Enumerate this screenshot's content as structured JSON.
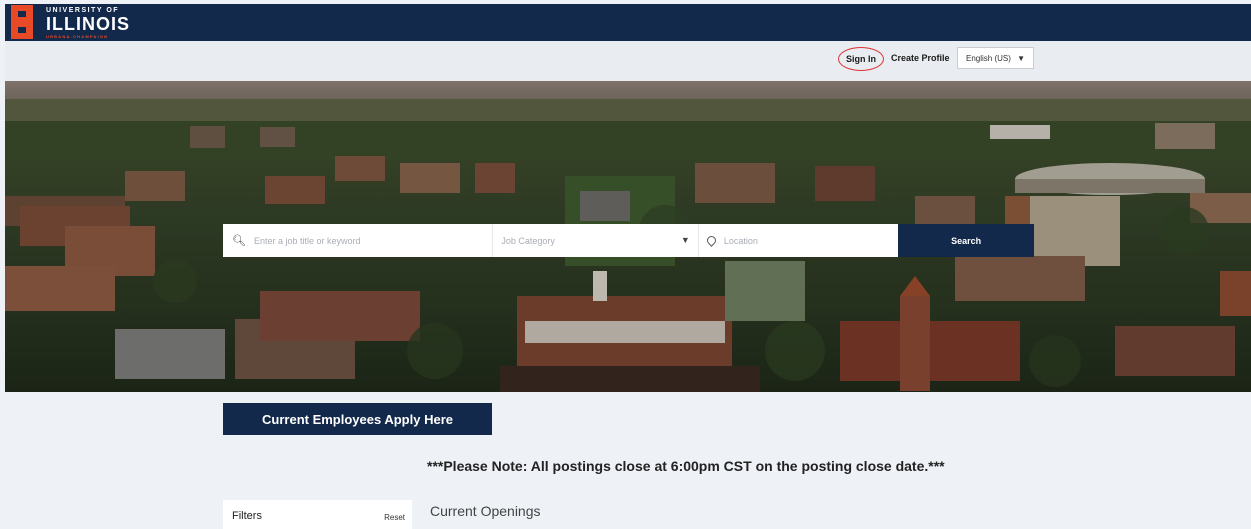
{
  "header": {
    "logo_line1": "UNIVERSITY OF",
    "logo_line2": "ILLINOIS",
    "logo_line3": "URBANA-CHAMPAIGN"
  },
  "utility": {
    "sign_in": "Sign In",
    "create_profile": "Create Profile",
    "language": "English (US)"
  },
  "search": {
    "keyword_placeholder": "Enter a job title or keyword",
    "category_placeholder": "Job Category",
    "location_placeholder": "Location",
    "button": "Search"
  },
  "main": {
    "employees_button": "Current Employees Apply Here",
    "notice": "***Please Note: All postings close at 6:00pm CST on the posting close date.***",
    "filters_title": "Filters",
    "reset": "Reset",
    "openings_title": "Current Openings"
  },
  "colors": {
    "navy": "#13294b",
    "orange": "#e84a27",
    "page_bg": "#eef1f6"
  }
}
